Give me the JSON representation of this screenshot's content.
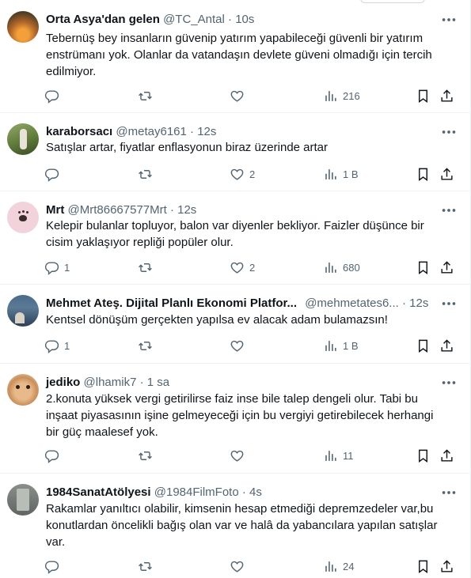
{
  "tweets": [
    {
      "name": "Orta Asya'dan gelen",
      "handle": "@TC_Antal",
      "dot": "·",
      "time": "10s",
      "lines": [
        "Tebernüş bey insanların güvenip yatırım yapabileceği güvenli bir yatırım",
        "enstrümanı yok. Olanlar da vatandaşın devlete güveni olmadığı için tercih",
        "edilmiyor."
      ],
      "replies": "",
      "retweets": "",
      "likes": "",
      "views": "216"
    },
    {
      "name": "karaborsacı",
      "handle": "@metay6161",
      "dot": "·",
      "time": "12s",
      "lines": [
        "Satışlar artar, fiyatlar enflasyonun biraz üzerinde artar"
      ],
      "replies": "",
      "retweets": "",
      "likes": "2",
      "views": "1 B"
    },
    {
      "name": "Mrt",
      "handle": "@Mrt86667577Mrt",
      "dot": "·",
      "time": "12s",
      "lines": [
        "Kelepir bulanlar topluyor, balon var diyenler bekliyor. Faizler düşünce bir",
        "cisim yaklaşıyor repliği popüler olur."
      ],
      "replies": "1",
      "retweets": "",
      "likes": "2",
      "views": "680"
    },
    {
      "name": "Mehmet Ateş. Dijital Planlı Ekonomi Platfor...",
      "handle": "@mehmetates6...",
      "dot": "·",
      "time": "12s",
      "lines": [
        "Kentsel dönüşüm gerçekten yapılsa ev alacak adam bulamazsın!"
      ],
      "replies": "1",
      "retweets": "",
      "likes": "",
      "views": "1 B"
    },
    {
      "name": "jediko",
      "handle": "@lhamik7",
      "dot": "·",
      "time": "1 sa",
      "lines": [
        "2.konuta yüksek vergi getirilirse faiz inse bile talep dengeli olur. Tabi bu",
        "inşaat piyasasının işine gelmeyeceği için bu vergiyi getirebilecek herhangi",
        "bir güç maalesef yok."
      ],
      "replies": "",
      "retweets": "",
      "likes": "",
      "views": "11"
    },
    {
      "name": "1984SanatAtölyesi",
      "handle": "@1984FilmFoto",
      "dot": "·",
      "time": "4s",
      "lines": [
        "Rakamlar yanıltıcı olabilir, kimsenin hesap etmediği depremzedeler var,bu",
        "konutlardan öncelikli bağış olan var ve halâ da yabancılara yapılan satışlar",
        "var."
      ],
      "replies": "",
      "retweets": "",
      "likes": "",
      "views": "24"
    }
  ],
  "icons": {
    "more": "more-icon",
    "reply": "reply-icon",
    "retweet": "retweet-icon",
    "like": "heart-icon",
    "views": "views-icon",
    "bookmark": "bookmark-icon",
    "share": "share-icon"
  },
  "colors": {
    "text": "#0f1419",
    "secondary": "#536471",
    "border": "#eff3f4"
  }
}
